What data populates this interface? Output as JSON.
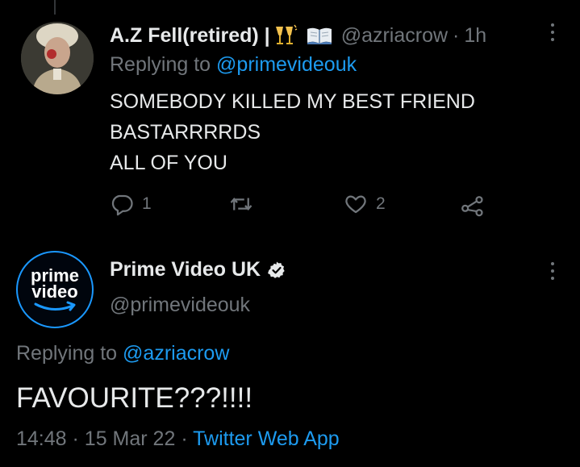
{
  "tweet1": {
    "display_name": "A.Z Fell(retired) |",
    "emoji_names": [
      "clinking-glasses-icon",
      "open-book-icon"
    ],
    "handle": "@azriacrow",
    "separator": "·",
    "timestamp": "1h",
    "replying_prefix": "Replying to ",
    "replying_to": "@primevideouk",
    "text_lines": [
      "SOMEBODY KILLED MY BEST FRIEND",
      "BASTARRRRDS",
      "ALL OF YOU"
    ],
    "reply_count": "1",
    "retweet_count": "",
    "like_count": "2"
  },
  "tweet2": {
    "display_name": "Prime Video UK",
    "verified_icon": "verified-badge-icon",
    "handle": "@primevideouk",
    "logo_line1": "prime",
    "logo_line2": "video",
    "replying_prefix": "Replying to ",
    "replying_to": "@azriacrow",
    "text": "FAVOURITE???!!!!",
    "time": "14:48",
    "sep1": "·",
    "date": "15 Mar 22",
    "sep2": "·",
    "source": "Twitter Web App"
  },
  "colors": {
    "background": "#000000",
    "text": "#e7e9ea",
    "muted": "#71767b",
    "link": "#1d9bf0"
  }
}
